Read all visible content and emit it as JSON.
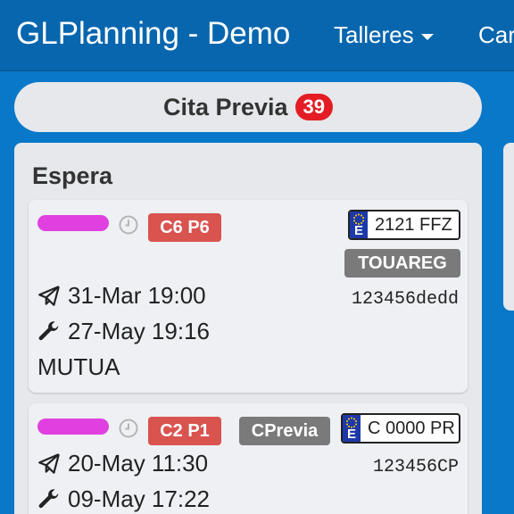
{
  "navbar": {
    "brand": "GLPlanning - Demo",
    "talleres": "Talleres",
    "next_item_partial": "Car"
  },
  "cita_previa": {
    "label": "Cita Previa",
    "count": "39"
  },
  "columns": [
    {
      "title": "Espera",
      "cards": [
        {
          "label_color": "#e040e0",
          "tag": "C6 P6",
          "plate": "2121 FFZ",
          "plate_country": "E",
          "model": "TOUAREG",
          "sent": "31-Mar 19:00",
          "ref": "123456dedd",
          "service": "27-May 19:16",
          "client": "MUTUA"
        },
        {
          "label_color": "#e040e0",
          "tag": "C2 P1",
          "type_tag": "CPrevia",
          "plate": "C 0000 PR",
          "plate_country": "E",
          "sent": "20-May 11:30",
          "ref": "123456CP",
          "service": "09-May 17:22"
        }
      ]
    }
  ],
  "icons": {
    "clock": "clock-icon",
    "send": "paper-plane-icon",
    "wrench": "wrench-icon",
    "caret": "caret-down-icon"
  },
  "colors": {
    "navbar": "#0766ae",
    "background": "#0a78c8",
    "tag_red": "#d9534f",
    "tag_grey": "#7a7a7a",
    "badge": "#e41d24"
  }
}
